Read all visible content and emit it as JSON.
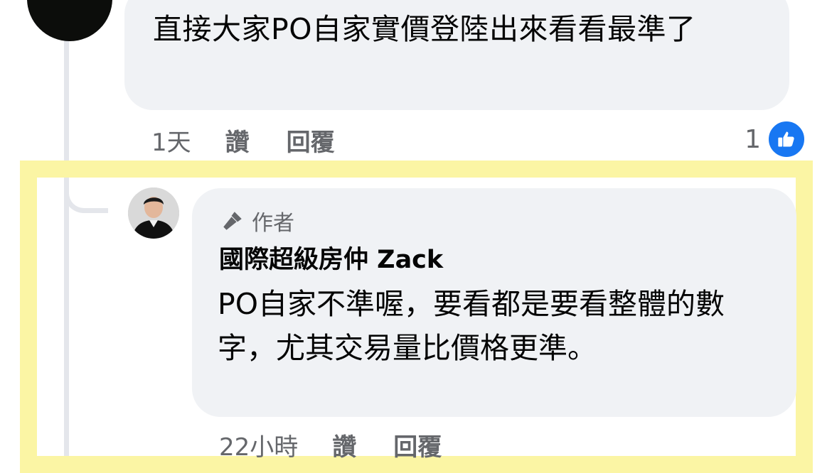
{
  "top_comment": {
    "text": "直接大家PO自家實價登陸出來看看最準了",
    "time": "1天",
    "like_label": "讚",
    "reply_label": "回覆",
    "reaction_count": "1"
  },
  "reply_comment": {
    "badge": "作者",
    "author": "國際超級房仲 Zack",
    "text": "PO自家不準喔，要看都是要看整體的數字，尤其交易量比價格更準。",
    "time": "22小時",
    "like_label": "讚",
    "reply_label": "回覆"
  },
  "colors": {
    "bubble": "#f0f2f5",
    "meta_text": "#65676b",
    "like_blue": "#1877f2",
    "highlight": "#fbf5a4"
  },
  "icons": {
    "author_badge": "microphone-icon",
    "reaction": "thumbs-up-icon"
  }
}
